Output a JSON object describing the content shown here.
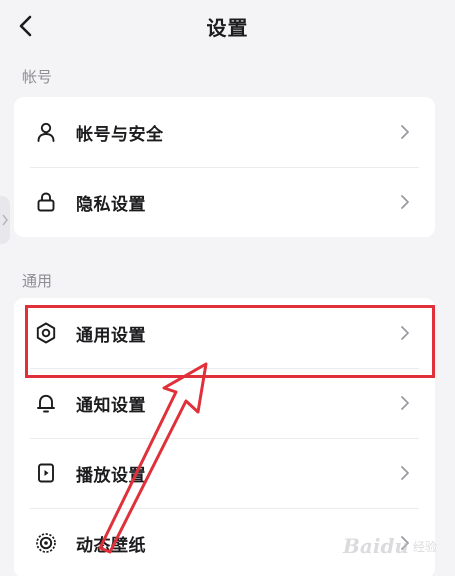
{
  "header": {
    "title": "设置"
  },
  "sections": [
    {
      "header": "帐号",
      "items": [
        {
          "label": "帐号与安全",
          "icon": "person-icon"
        },
        {
          "label": "隐私设置",
          "icon": "lock-icon"
        }
      ]
    },
    {
      "header": "通用",
      "items": [
        {
          "label": "通用设置",
          "icon": "gear-icon"
        },
        {
          "label": "通知设置",
          "icon": "bell-icon"
        },
        {
          "label": "播放设置",
          "icon": "play-device-icon"
        },
        {
          "label": "动态壁纸",
          "icon": "live-wallpaper-icon"
        }
      ]
    }
  ],
  "watermark": {
    "text": "Baidu",
    "sub": "经验"
  },
  "colors": {
    "background": "#f4f4f6",
    "card": "#ffffff",
    "highlight": "#e0303a",
    "secondary_text": "#8e8e93",
    "primary_text": "#1c1c1e"
  }
}
